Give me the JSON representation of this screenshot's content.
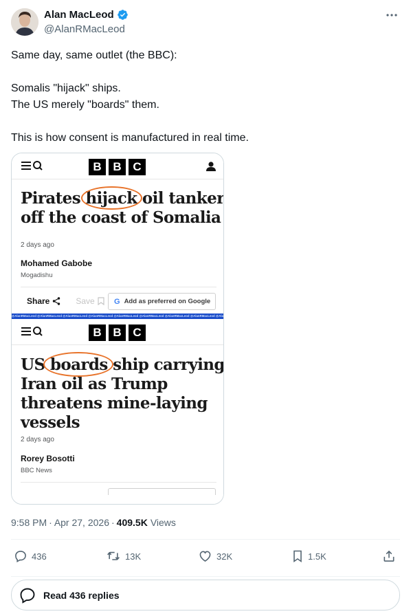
{
  "author": {
    "name": "Alan MacLeod",
    "handle": "@AlanRMacLeod",
    "verified": true,
    "accent_color": "#1d9bf0"
  },
  "tweet": {
    "line1": "Same day, same outlet (the BBC):",
    "line2": "Somalis \"hijack\" ships.",
    "line3": "The US merely \"boards\" them.",
    "line4": "This is how consent is manufactured in real time."
  },
  "media": {
    "logo_letters": [
      "B",
      "B",
      "C"
    ],
    "watermark": "@AlanRMacLeod @AlanRMacLeod @AlanRMacLeod @AlanRMacLeod @AlanRMacLeod @AlanRMacLeod @AlanRMacLeod @AlanRMacLeod @AlanRMacLeod @AlanRMacLeod @AlanRMacLeod @AlanRMacLeod",
    "highlight_color": "#e8732a",
    "article1": {
      "headline_before": "Pirates ",
      "headline_highlight": "hijack",
      "headline_after_line1": " oil tanker",
      "headline_line2": "off the coast of Somalia",
      "date": "2 days ago",
      "byline": "Mohamed Gabobe",
      "location": "Mogadishu",
      "share_label": "Share",
      "save_label": "Save",
      "preferred_label": "Add as preferred on Google"
    },
    "article2": {
      "headline_before": "US ",
      "headline_highlight": "boards",
      "headline_after_line1": " ship carrying",
      "headline_line2": "Iran oil as Trump",
      "headline_line3": "threatens mine-laying",
      "headline_line4": "vessels",
      "date": "2 days ago",
      "byline": "Rorey Bosotti",
      "location": "BBC News"
    }
  },
  "meta": {
    "time": "9:58 PM",
    "date": "Apr 27, 2026",
    "views_count": "409.5K",
    "views_label": "Views",
    "separator": "·"
  },
  "actions": {
    "replies": "436",
    "reposts": "13K",
    "likes": "32K",
    "bookmarks": "1.5K"
  },
  "read_replies": "Read 436 replies"
}
